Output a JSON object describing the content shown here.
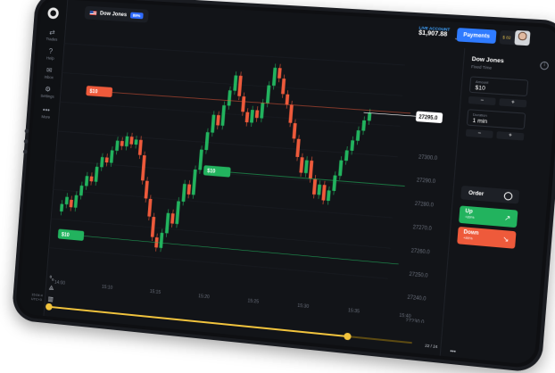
{
  "sidebar": {
    "items": [
      {
        "label": "Trades",
        "icon": "trades-icon"
      },
      {
        "label": "Help",
        "icon": "help-icon"
      },
      {
        "label": "Inbox",
        "icon": "mail-icon"
      },
      {
        "label": "Settings",
        "icon": "gear-icon"
      },
      {
        "label": "More",
        "icon": "more-icon"
      }
    ]
  },
  "header": {
    "asset_name": "Dow Jones",
    "asset_badge": "89%",
    "account_label": "LIVE ACCOUNT",
    "balance": "$1,907.88",
    "payments_label": "Payments",
    "avatar_badge": "$ 82"
  },
  "chart": {
    "current_price": "27295.0",
    "price_levels": [
      "27300.0",
      "27290.0",
      "27280.0",
      "27270.0",
      "27260.0",
      "27250.0",
      "27240.0",
      "27230.0"
    ],
    "time_labels": [
      "14:00",
      "15:10",
      "15:15",
      "15:20",
      "15:25",
      "15:30",
      "15:35",
      "15:40"
    ],
    "markers": [
      {
        "label": "$10",
        "color": "#ee5a3b"
      },
      {
        "label": "$10",
        "color": "#22b35e"
      },
      {
        "label": "$10",
        "color": "#22b35e"
      }
    ],
    "colors": {
      "up": "#22b35e",
      "down": "#ee5a3b"
    },
    "candles": [
      {
        "o": 27247,
        "c": 27250
      },
      {
        "o": 27250,
        "c": 27253
      },
      {
        "o": 27252,
        "c": 27249
      },
      {
        "o": 27249,
        "c": 27254
      },
      {
        "o": 27254,
        "c": 27258
      },
      {
        "o": 27258,
        "c": 27262
      },
      {
        "o": 27262,
        "c": 27260
      },
      {
        "o": 27260,
        "c": 27266
      },
      {
        "o": 27266,
        "c": 27270
      },
      {
        "o": 27270,
        "c": 27268
      },
      {
        "o": 27268,
        "c": 27273
      },
      {
        "o": 27273,
        "c": 27277
      },
      {
        "o": 27277,
        "c": 27275
      },
      {
        "o": 27275,
        "c": 27279
      },
      {
        "o": 27279,
        "c": 27276
      },
      {
        "o": 27276,
        "c": 27278
      },
      {
        "o": 27278,
        "c": 27272
      },
      {
        "o": 27272,
        "c": 27262
      },
      {
        "o": 27262,
        "c": 27255
      },
      {
        "o": 27255,
        "c": 27248
      },
      {
        "o": 27248,
        "c": 27240
      },
      {
        "o": 27240,
        "c": 27236
      },
      {
        "o": 27236,
        "c": 27242
      },
      {
        "o": 27242,
        "c": 27250
      },
      {
        "o": 27250,
        "c": 27246
      },
      {
        "o": 27246,
        "c": 27255
      },
      {
        "o": 27255,
        "c": 27262
      },
      {
        "o": 27262,
        "c": 27258
      },
      {
        "o": 27258,
        "c": 27268
      },
      {
        "o": 27268,
        "c": 27276
      },
      {
        "o": 27276,
        "c": 27283
      },
      {
        "o": 27283,
        "c": 27290
      },
      {
        "o": 27290,
        "c": 27286
      },
      {
        "o": 27286,
        "c": 27294
      },
      {
        "o": 27294,
        "c": 27300
      },
      {
        "o": 27300,
        "c": 27306
      },
      {
        "o": 27306,
        "c": 27298
      },
      {
        "o": 27298,
        "c": 27292
      },
      {
        "o": 27292,
        "c": 27288
      },
      {
        "o": 27288,
        "c": 27293
      },
      {
        "o": 27293,
        "c": 27290
      },
      {
        "o": 27290,
        "c": 27296
      },
      {
        "o": 27296,
        "c": 27303
      },
      {
        "o": 27303,
        "c": 27310
      },
      {
        "o": 27310,
        "c": 27306
      },
      {
        "o": 27306,
        "c": 27300
      },
      {
        "o": 27300,
        "c": 27296
      },
      {
        "o": 27296,
        "c": 27289
      },
      {
        "o": 27289,
        "c": 27283
      },
      {
        "o": 27283,
        "c": 27276
      },
      {
        "o": 27276,
        "c": 27270
      },
      {
        "o": 27270,
        "c": 27275
      },
      {
        "o": 27275,
        "c": 27268
      },
      {
        "o": 27268,
        "c": 27262
      },
      {
        "o": 27262,
        "c": 27266
      },
      {
        "o": 27266,
        "c": 27260
      },
      {
        "o": 27260,
        "c": 27264
      },
      {
        "o": 27264,
        "c": 27270
      },
      {
        "o": 27270,
        "c": 27276
      },
      {
        "o": 27276,
        "c": 27280
      },
      {
        "o": 27280,
        "c": 27284
      },
      {
        "o": 27284,
        "c": 27288
      },
      {
        "o": 27288,
        "c": 27292
      },
      {
        "o": 27292,
        "c": 27295
      }
    ]
  },
  "panel": {
    "title": "Dow Jones",
    "subtitle": "Fixed Time",
    "amount_label": "Amount",
    "amount_value": "$10",
    "duration_label": "Duration",
    "duration_value": "1 min",
    "minus": "−",
    "plus": "+",
    "order_label": "Order",
    "up_label": "Up",
    "up_pct": "+89%",
    "down_label": "Down",
    "down_pct": "+89%"
  },
  "bottom": {
    "timestamp": "15:04:4\nUTC+3",
    "pager": "22 / 24",
    "more": "•••",
    "slider_left": 0.0,
    "slider_right": 0.83
  }
}
